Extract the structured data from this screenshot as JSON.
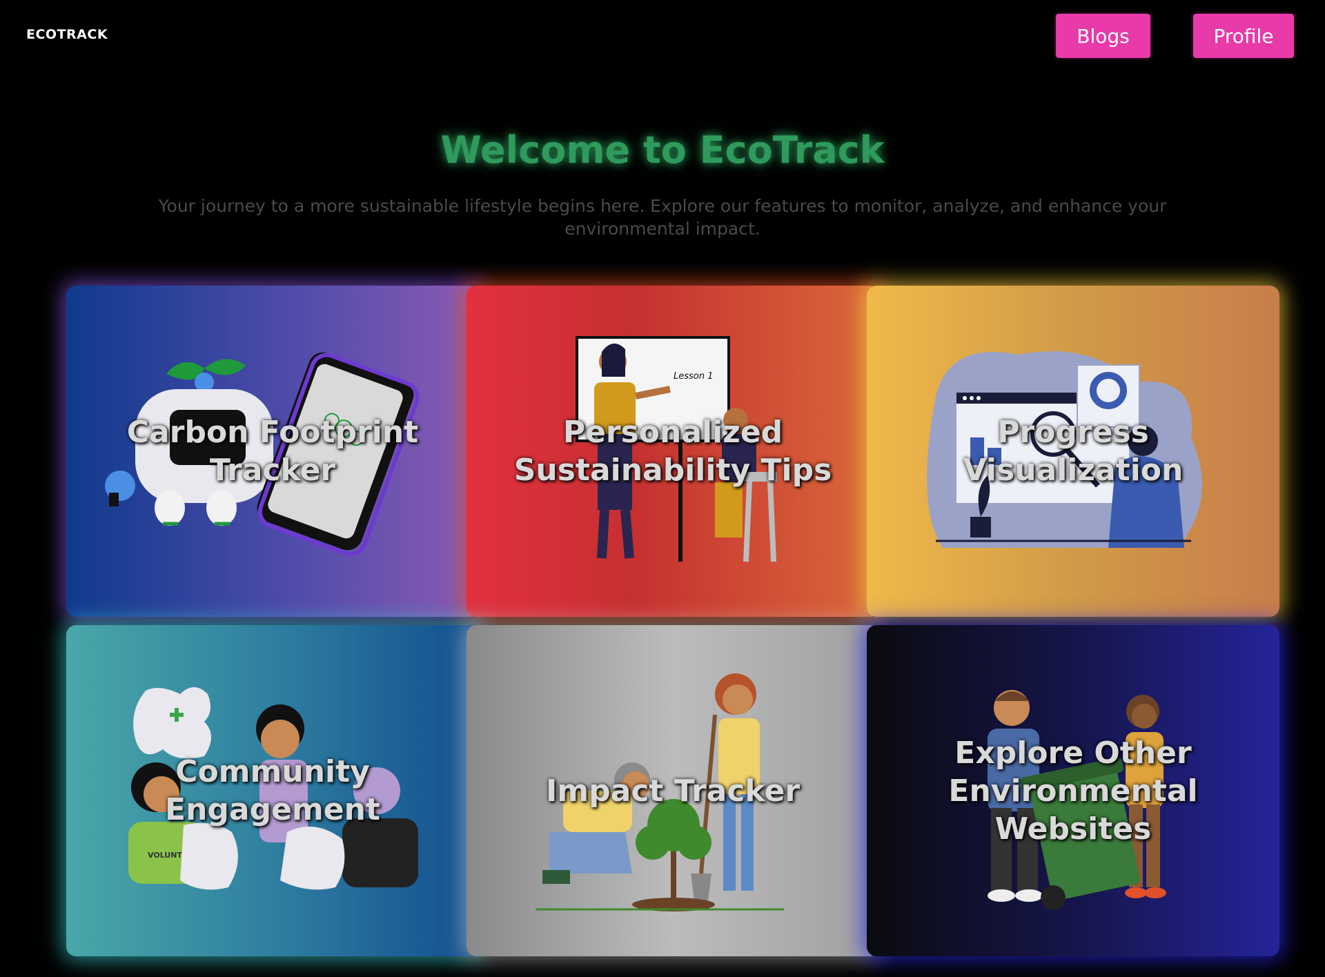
{
  "app": {
    "brand": "ECOTRACK"
  },
  "nav": {
    "blogs_label": "Blogs",
    "profile_label": "Profile",
    "accent_color": "#e83aa9"
  },
  "hero": {
    "title": "Welcome to EcoTrack",
    "subtitle": "Your journey to a more sustainable lifestyle begins here. Explore our features to monitor, analyze, and enhance your environmental impact.",
    "title_color": "#2e9a5b"
  },
  "cards": [
    {
      "title": "Carbon Footprint Tracker",
      "illustration": "robot-phone-illustration",
      "glow": "#8250dc"
    },
    {
      "title": "Personalized Sustainability Tips",
      "illustration": "teacher-lesson-illustration",
      "board_text": "Lesson 1",
      "glow": "#e65028"
    },
    {
      "title": "Progress Visualization",
      "illustration": "analytics-dashboard-illustration",
      "glow": "#f0c83c"
    },
    {
      "title": "Community Engagement",
      "illustration": "puzzle-community-illustration",
      "shirt_text": "VOLUNTE",
      "glow": "#3cdcdc"
    },
    {
      "title": "Impact Tracker",
      "illustration": "tree-planting-illustration",
      "glow": "#d2d2d2"
    },
    {
      "title": "Explore Other Environmental Websites",
      "illustration": "recycling-bin-illustration",
      "glow": "#2828e6"
    }
  ]
}
